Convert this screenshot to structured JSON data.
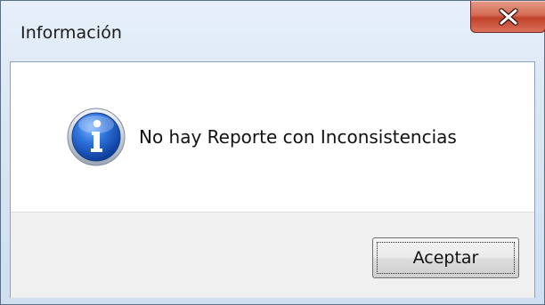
{
  "window": {
    "title": "Información",
    "close_icon": "close-x-icon"
  },
  "dialog": {
    "icon": "info-icon",
    "message": "No hay Reporte con Inconsistencias",
    "ok_label": "Aceptar"
  },
  "colors": {
    "frame": "#dbe7f4",
    "close_button": "#c2412a",
    "info_icon": "#1c63c9"
  }
}
